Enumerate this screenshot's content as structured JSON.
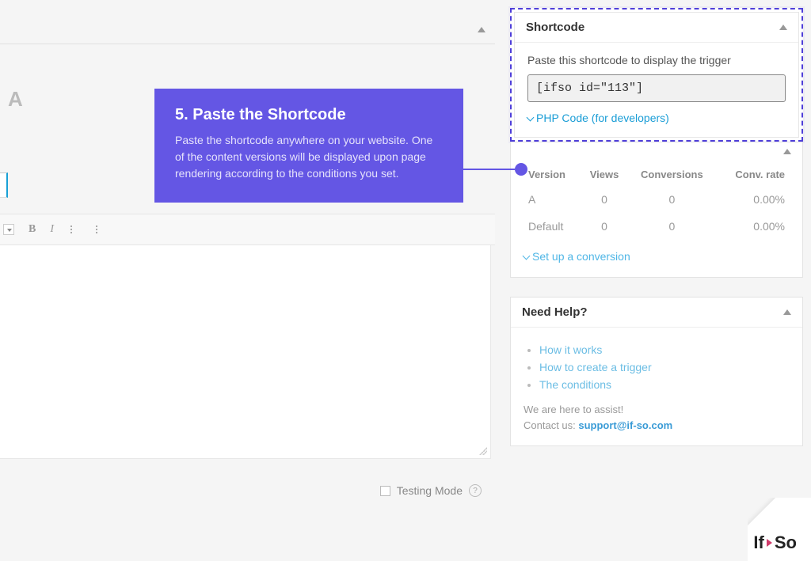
{
  "callout": {
    "title": "5. Paste the Shortcode",
    "body": "Paste the shortcode anywhere on your website. One of the content versions will be displayed upon page rendering according to the conditions you set."
  },
  "editor": {
    "version_label": "A",
    "toolbar": {
      "bold": "B",
      "italic": "I"
    },
    "testing_mode_label": "Testing Mode",
    "help_mark": "?"
  },
  "shortcode_panel": {
    "title": "Shortcode",
    "instruction": "Paste this shortcode to display the trigger",
    "code": "[ifso id=\"113\"]",
    "php_link": "PHP Code (for developers)"
  },
  "stats_panel": {
    "headers": [
      "Version",
      "Views",
      "Conversions",
      "Conv. rate"
    ],
    "rows": [
      {
        "version": "A",
        "views": "0",
        "conversions": "0",
        "rate": "0.00%"
      },
      {
        "version": "Default",
        "views": "0",
        "conversions": "0",
        "rate": "0.00%"
      }
    ],
    "setup_link": "Set up a conversion"
  },
  "help_panel": {
    "title": "Need Help?",
    "links": [
      "How it works",
      "How to create a trigger",
      "The conditions"
    ],
    "footer_line1": "We are here to assist!",
    "footer_line2_prefix": "Contact us: ",
    "footer_email": "support@if-so.com"
  },
  "brand": {
    "part1": "If",
    "part2": "So"
  }
}
